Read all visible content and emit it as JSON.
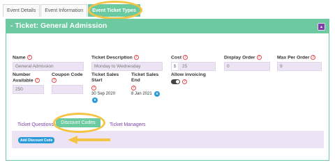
{
  "top_tabs": [
    "Event Details",
    "Event Information",
    "Event Ticket Types"
  ],
  "card": {
    "title": "- Ticket: General Admission",
    "collapse_symbol": "▴"
  },
  "help_glyph": "?",
  "fields": {
    "name": {
      "label": "Name",
      "value": "General Admission"
    },
    "ticket_description": {
      "label": "Ticket Description",
      "value": "Monday to Wednesday"
    },
    "cost": {
      "label": "Cost",
      "currency": "$",
      "value": "25"
    },
    "display_order": {
      "label": "Display Order",
      "value": "0"
    },
    "max_per_order": {
      "label": "Max Per Order",
      "value": "9"
    },
    "number_available": {
      "label_line1": "Number",
      "label_line2": "Available",
      "value": "250"
    },
    "coupon_code": {
      "label": "Coupon Code",
      "value": ""
    },
    "sales_start": {
      "label_line1": "Ticket Sales",
      "label_line2": "Start",
      "value": "30 Sep 2020"
    },
    "sales_end": {
      "label_line1": "Ticket Sales",
      "label_line2": "End",
      "value": "8 Jan 2021"
    },
    "allow_invoicing": {
      "label": "Allow invoicing",
      "enabled": false
    }
  },
  "clear_symbol": "x",
  "sub_tabs": [
    "Ticket Questions",
    "Discount Codes",
    "Ticket Managers"
  ],
  "active_sub_tab": "Discount Codes",
  "add_button_label": "Add Discount Code",
  "colors": {
    "accent_green": "#6cc9a0",
    "input_purple": "#ece4f4",
    "highlight_yellow": "#f6c445",
    "button_blue": "#2a9ad8",
    "help_red": "#e04a4a",
    "collapse_purple": "#7b3fa5"
  }
}
